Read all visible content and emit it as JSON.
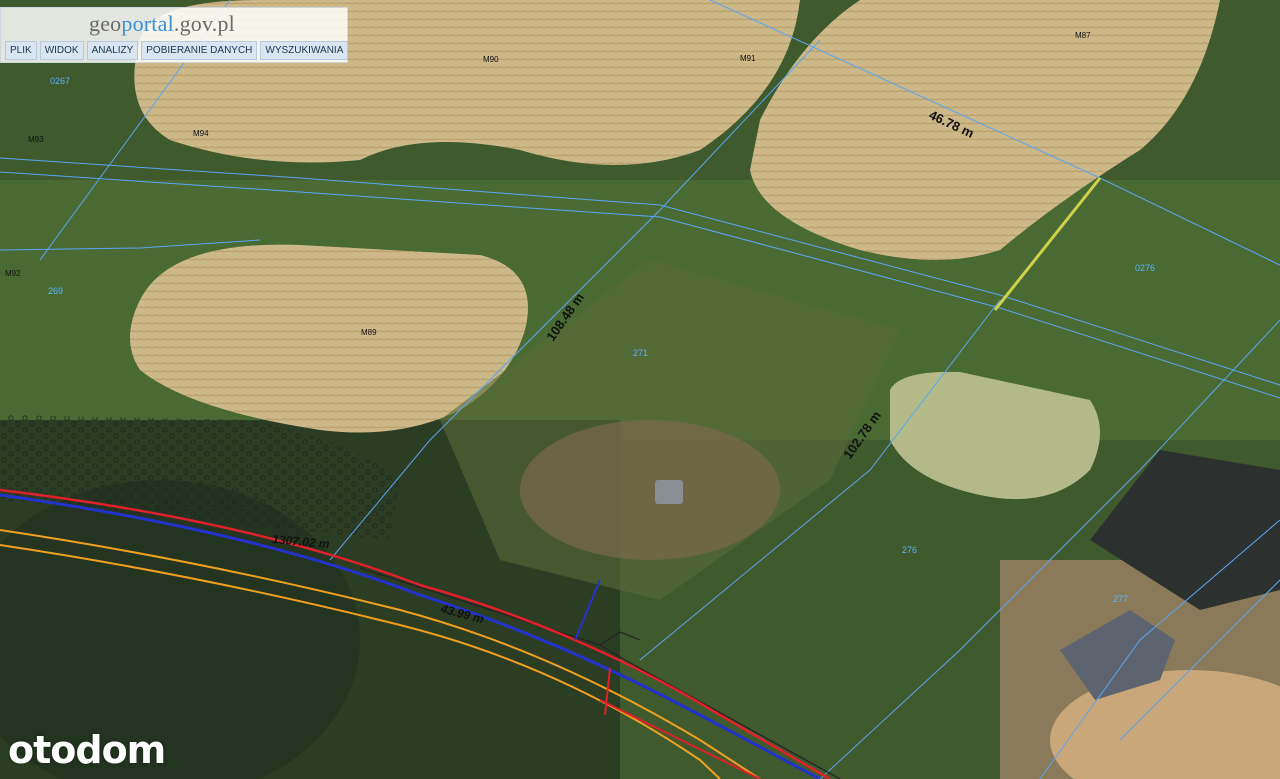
{
  "header": {
    "logo_prefix": "geo",
    "logo_accent": "portal",
    "logo_suffix": ".gov.pl"
  },
  "menu": {
    "items": [
      {
        "label": "PLIK"
      },
      {
        "label": "WIDOK"
      },
      {
        "label": "ANALIZY"
      },
      {
        "label": "POBIERANIE DANYCH"
      },
      {
        "label": "WYSZUKIWANIA"
      }
    ]
  },
  "map": {
    "measurements": {
      "top_right": "46.78 m",
      "left_side": "108.48 m",
      "right_side": "102.78 m",
      "road_length": "1307.02 m",
      "road_short": "43.99 m"
    },
    "parcels": {
      "p0267": "0267",
      "p269": "269",
      "p271": "271",
      "p276": "276",
      "p0276": "0276",
      "p277": "277",
      "m90": "M90",
      "m91": "M91",
      "m87": "M87",
      "m94": "M94",
      "m93": "M93",
      "m92": "M92",
      "m89": "M89"
    },
    "colors": {
      "boundary_blue": "#5aa6f0",
      "road_red": "#e0202a",
      "road_orange": "#f0a020",
      "road_blue": "#2233cc"
    }
  },
  "watermark": {
    "text": "otodom"
  }
}
